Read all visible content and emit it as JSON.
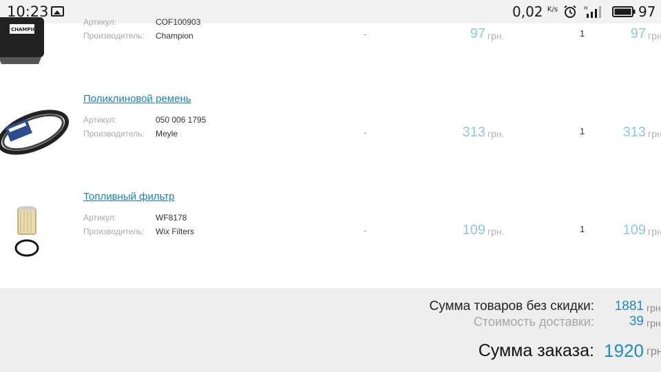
{
  "status_bar": {
    "time": "10:23",
    "speed": "0,02",
    "speed_unit": "K/s",
    "battery": "97",
    "icons": [
      "image-icon",
      "alarm-icon",
      "signal-icon",
      "battery-icon"
    ]
  },
  "cart": {
    "items": [
      {
        "name": "",
        "article_label": "Артикул:",
        "article": "COF100903",
        "maker_label": "Производитель:",
        "maker": "Champion",
        "discount": "-",
        "price": "97",
        "currency": "грн.",
        "qty": "1",
        "total": "97",
        "total_currency": "грн"
      },
      {
        "name": "Поликлиновой ремень",
        "article_label": "Артикул:",
        "article": "050 006 1795",
        "maker_label": "Производитель:",
        "maker": "Meyle",
        "discount": "-",
        "price": "313",
        "currency": "грн.",
        "qty": "1",
        "total": "313",
        "total_currency": "грн"
      },
      {
        "name": "Топливный фильтр",
        "article_label": "Артикул:",
        "article": "WF8178",
        "maker_label": "Производитель:",
        "maker": "Wix Filters",
        "discount": "-",
        "price": "109",
        "currency": "грн.",
        "qty": "1",
        "total": "109",
        "total_currency": "грн"
      }
    ]
  },
  "summary": {
    "subtotal_label": "Сумма товаров без скидки:",
    "subtotal": "1881",
    "delivery_label": "Стоимость доставки:",
    "delivery": "39",
    "order_label": "Сумма заказа:",
    "order_total": "1920",
    "currency": "грн"
  },
  "colors": {
    "link": "#1d7fb5",
    "price": "#8fc7dd",
    "accent": "#1f8ac0",
    "summary_bg": "#eeeeee"
  }
}
